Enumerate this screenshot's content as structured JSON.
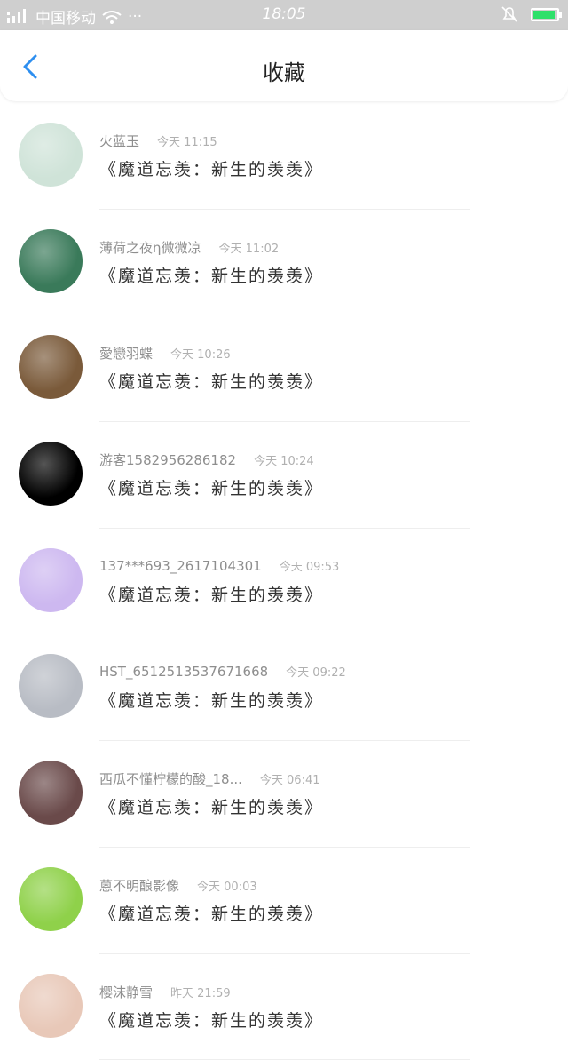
{
  "status_bar": {
    "carrier": "中国移动",
    "time": "18:05",
    "dots": "···"
  },
  "header": {
    "title": "收藏"
  },
  "favorites": [
    {
      "user": "火蓝玉",
      "time": "今天 11:15",
      "title": "《魔道忘羡：新生的羡羡》",
      "avatar_color": "#cfe3d8",
      "avatar_icon": "avatar-girl-ancient"
    },
    {
      "user": "薄荷之夜η微微凉",
      "time": "今天 11:02",
      "title": "《魔道忘羡：新生的羡羡》",
      "avatar_color": "#3a7a5a",
      "avatar_icon": "avatar-waterfall"
    },
    {
      "user": "愛戀羽蝶",
      "time": "今天 10:26",
      "title": "《魔道忘羡：新生的羡羡》",
      "avatar_color": "#7a5a3a",
      "avatar_icon": "avatar-child"
    },
    {
      "user": "游客1582956286182",
      "time": "今天 10:24",
      "title": "《魔道忘羡：新生的羡羡》",
      "avatar_color": "#000000",
      "avatar_icon": "avatar-laughing-face"
    },
    {
      "user": "137***693_2617104301",
      "time": "今天 09:53",
      "title": "《魔道忘羡：新生的羡羡》",
      "avatar_color": "#cdb8f0",
      "avatar_icon": "avatar-chat-bubble"
    },
    {
      "user": "HST_6512513537671668",
      "time": "今天 09:22",
      "title": "《魔道忘羡：新生的羡羡》",
      "avatar_color": "#b8bcc4",
      "avatar_icon": "avatar-anime-figure"
    },
    {
      "user": "西瓜不懂柠檬的酸_18...",
      "time": "今天 06:41",
      "title": "《魔道忘羡：新生的羡羡》",
      "avatar_color": "#6a4a4a",
      "avatar_icon": "avatar-anime-girl"
    },
    {
      "user": "蒽不明酿影像",
      "time": "今天 00:03",
      "title": "《魔道忘羡：新生的羡羡》",
      "avatar_color": "#8fd14a",
      "avatar_icon": "avatar-cartoon-pig"
    },
    {
      "user": "樱沫静雪",
      "time": "昨天 21:59",
      "title": "《魔道忘羡：新生的羡羡》",
      "avatar_color": "#e8c8b8",
      "avatar_icon": "avatar-girl"
    }
  ]
}
